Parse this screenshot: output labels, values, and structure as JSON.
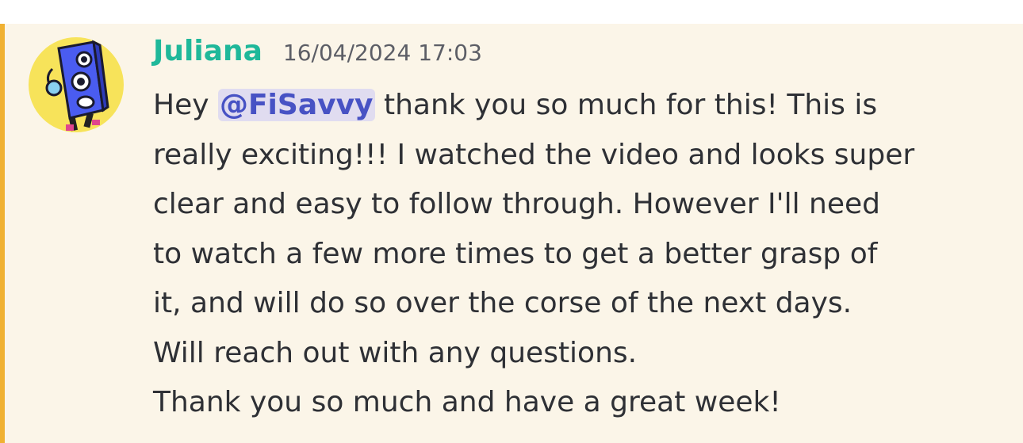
{
  "message": {
    "author": "Juliana",
    "timestamp": "16/04/2024 17:03",
    "colors": {
      "author": "#1fb89a",
      "highlight_bar": "#f0b132",
      "mention_text": "#4752c4",
      "mention_bg": "#e0dcf0",
      "background": "#fbf5e8"
    },
    "lines": [
      {
        "before": "Hey ",
        "mention": "@FiSavvy",
        "after": " thank you so much for this! This is"
      },
      {
        "text": "really exciting!!! I watched the video and looks super"
      },
      {
        "text": "clear and easy to follow through. However I'll need"
      },
      {
        "text": "to watch a few more times to get a better grasp of"
      },
      {
        "text": "it, and will do so over the corse of the next days."
      },
      {
        "text": "Will reach out with any questions."
      },
      {
        "text": "Thank you so much and have a great week!"
      }
    ]
  },
  "avatar": {
    "icon": "speaker-character-avatar"
  }
}
